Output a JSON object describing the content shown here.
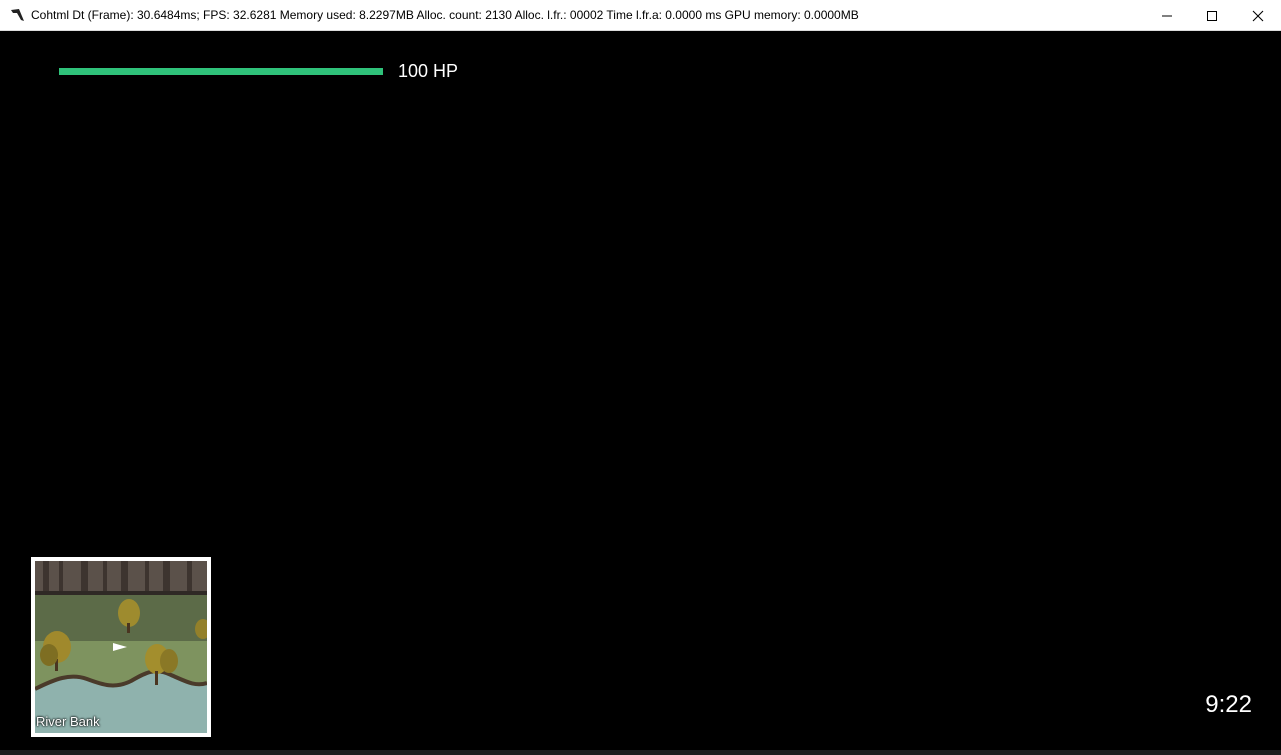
{
  "window": {
    "title": "Cohtml Dt (Frame): 30.6484ms; FPS: 32.6281 Memory used: 8.2297MB Alloc. count: 2130 Alloc. l.fr.: 00002 Time l.fr.a: 0.0000 ms GPU memory: 0.0000MB",
    "controls": [
      "minimize-icon",
      "maximize-icon",
      "close-icon"
    ]
  },
  "hud": {
    "hp_label": "100 HP",
    "hp_fraction": 1.0,
    "hp_color": "#2fc27a",
    "clock": "9:22"
  },
  "minimap": {
    "location_label": "River Bank",
    "player_marker_icon": "player-arrow-icon"
  }
}
